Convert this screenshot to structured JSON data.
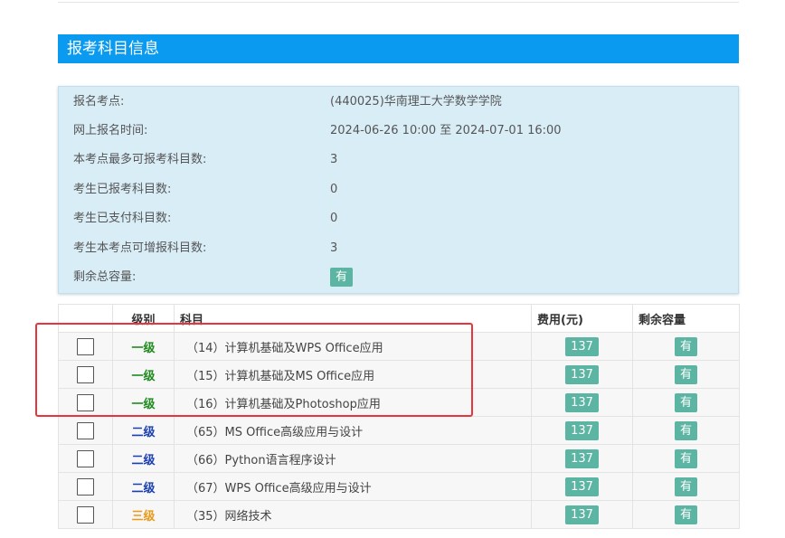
{
  "section_title": "报考科目信息",
  "info": [
    {
      "label": "报名考点:",
      "value": "(440025)华南理工大学数学学院"
    },
    {
      "label": "网上报名时间:",
      "value": "2024-06-26 10:00 至 2024-07-01 16:00"
    },
    {
      "label": "本考点最多可报考科目数:",
      "value": "3"
    },
    {
      "label": "考生已报考科目数:",
      "value": "0"
    },
    {
      "label": "考生已支付科目数:",
      "value": "0"
    },
    {
      "label": "考生本考点可增报科目数:",
      "value": "3"
    },
    {
      "label": "剩余总容量:",
      "badge": "有"
    }
  ],
  "table": {
    "headers": [
      "",
      "级别",
      "科目",
      "费用(元)",
      "剩余容量"
    ],
    "rows": [
      {
        "level": "一级",
        "level_color": "#1e8a1e",
        "subject": "（14）计算机基础及WPS Office应用",
        "fee": "137",
        "capacity": "有"
      },
      {
        "level": "一级",
        "level_color": "#1e8a1e",
        "subject": "（15）计算机基础及MS Office应用",
        "fee": "137",
        "capacity": "有"
      },
      {
        "level": "一级",
        "level_color": "#1e8a1e",
        "subject": "（16）计算机基础及Photoshop应用",
        "fee": "137",
        "capacity": "有"
      },
      {
        "level": "二级",
        "level_color": "#1a3fb0",
        "subject": "（65）MS Office高级应用与设计",
        "fee": "137",
        "capacity": "有"
      },
      {
        "level": "二级",
        "level_color": "#1a3fb0",
        "subject": "（66）Python语言程序设计",
        "fee": "137",
        "capacity": "有"
      },
      {
        "level": "二级",
        "level_color": "#1a3fb0",
        "subject": "（67）WPS Office高级应用与设计",
        "fee": "137",
        "capacity": "有"
      },
      {
        "level": "三级",
        "level_color": "#e89a1a",
        "subject": "（35）网络技术",
        "fee": "137",
        "capacity": "有"
      }
    ]
  },
  "colors": {
    "header_bar": "#0a9bf0",
    "info_bg": "#d9edf7",
    "badge": "#5bb5a2",
    "annotation": "#e8343c"
  }
}
